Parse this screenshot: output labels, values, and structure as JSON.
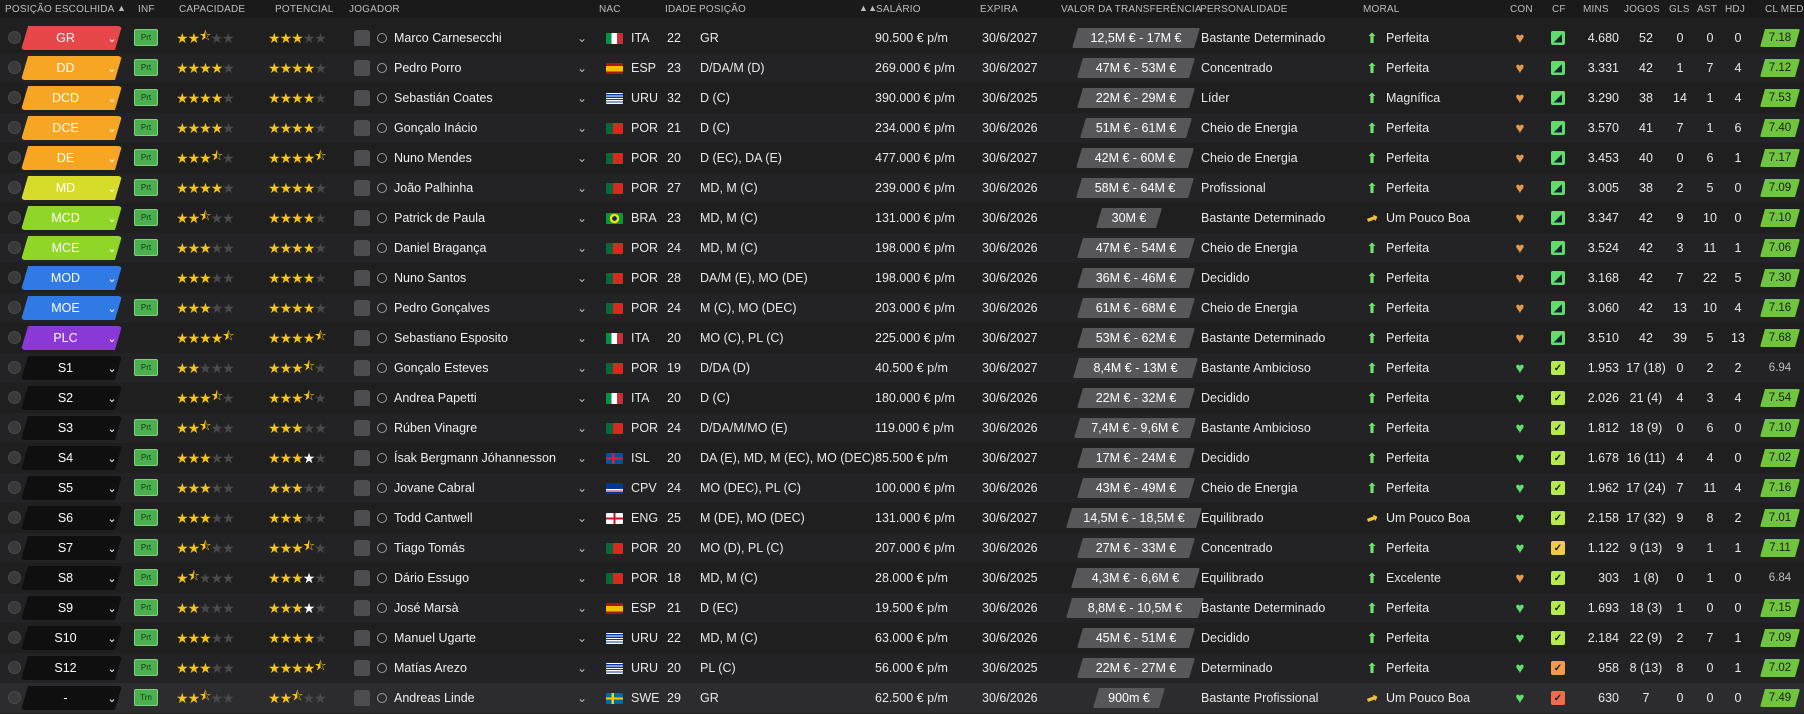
{
  "headers": {
    "posicao": "POSIÇÃO ESCOLHIDA",
    "inf": "INF",
    "capacidade": "CAPACIDADE",
    "potencial": "POTENCIAL",
    "jogador": "JOGADOR",
    "nac": "NAC",
    "idade": "IDADE",
    "posicao2": "POSIÇÃO",
    "salario": "SALÁRIO",
    "expira": "EXPIRA",
    "valor": "VALOR DA TRANSFERÊNCIA",
    "personalidade": "PERSONALIDADE",
    "moral": "MORAL",
    "con": "CON",
    "cf": "CF",
    "mins": "MINS",
    "jogos": "JOGOS",
    "gls": "GLS",
    "ast": "AST",
    "hdj": "HDJ",
    "cl_med": "CL MED"
  },
  "colors": {
    "gold_star": "#f5c518",
    "green": "#4caf50",
    "orange_heart": "#e7964a",
    "green_heart": "#5fe06f"
  },
  "players": [
    {
      "pos": "GR",
      "pos_color": "#e8474a",
      "inf": "Prt",
      "cap": 2.5,
      "pot": 3,
      "pot_white": 0,
      "name": "Marco Carnesecchi",
      "nac": "ITA",
      "flag": "ita",
      "age": "22",
      "position": "GR",
      "salary": "90.500 € p/m",
      "expires": "30/6/2027",
      "value": "12,5M € - 17M €",
      "personality": "Bastante Determinado",
      "moral": "Perfeita",
      "moral_icon": "up",
      "con": "orange",
      "cf": "green",
      "mins": "4.680",
      "jogos": "52",
      "gls": "0",
      "ast": "0",
      "hdj": "0",
      "cl": "7.18",
      "cl_grey": false
    },
    {
      "pos": "DD",
      "pos_color": "#f6a623",
      "inf": "Prt",
      "cap": 4,
      "pot": 4,
      "pot_white": 0,
      "name": "Pedro Porro",
      "nac": "ESP",
      "flag": "esp",
      "age": "23",
      "position": "D/DA/M (D)",
      "salary": "269.000 € p/m",
      "expires": "30/6/2027",
      "value": "47M € - 53M €",
      "personality": "Concentrado",
      "moral": "Perfeita",
      "moral_icon": "up",
      "con": "orange",
      "cf": "green",
      "mins": "3.331",
      "jogos": "42",
      "gls": "1",
      "ast": "7",
      "hdj": "4",
      "cl": "7.12",
      "cl_grey": false
    },
    {
      "pos": "DCD",
      "pos_color": "#f6a623",
      "inf": "Prt",
      "cap": 4,
      "pot": 4,
      "pot_white": 0,
      "name": "Sebastián Coates",
      "nac": "URU",
      "flag": "uru",
      "age": "32",
      "position": "D (C)",
      "salary": "390.000 € p/m",
      "expires": "30/6/2025",
      "value": "22M € - 29M €",
      "personality": "Líder",
      "moral": "Magnífica",
      "moral_icon": "up",
      "con": "orange",
      "cf": "green",
      "mins": "3.290",
      "jogos": "38",
      "gls": "14",
      "ast": "1",
      "hdj": "4",
      "cl": "7.53",
      "cl_grey": false
    },
    {
      "pos": "DCE",
      "pos_color": "#f6a623",
      "inf": "Prt",
      "cap": 4,
      "pot": 4,
      "pot_white": 0,
      "name": "Gonçalo Inácio",
      "nac": "POR",
      "flag": "por",
      "age": "21",
      "position": "D (C)",
      "salary": "234.000 € p/m",
      "expires": "30/6/2026",
      "value": "51M € - 61M €",
      "personality": "Cheio de Energia",
      "moral": "Perfeita",
      "moral_icon": "up",
      "con": "orange",
      "cf": "green",
      "mins": "3.570",
      "jogos": "41",
      "gls": "7",
      "ast": "1",
      "hdj": "6",
      "cl": "7.40",
      "cl_grey": false
    },
    {
      "pos": "DE",
      "pos_color": "#f6a623",
      "inf": "Prt",
      "cap": 3.5,
      "pot": 4.5,
      "pot_white": 0,
      "name": "Nuno Mendes",
      "nac": "POR",
      "flag": "por",
      "age": "20",
      "position": "D (EC), DA (E)",
      "salary": "477.000 € p/m",
      "expires": "30/6/2027",
      "value": "42M € - 60M €",
      "personality": "Cheio de Energia",
      "moral": "Perfeita",
      "moral_icon": "up",
      "con": "orange",
      "cf": "green",
      "mins": "3.453",
      "jogos": "40",
      "gls": "0",
      "ast": "6",
      "hdj": "1",
      "cl": "7.17",
      "cl_grey": false
    },
    {
      "pos": "MD",
      "pos_color": "#d7dc2a",
      "inf": "Prt",
      "cap": 4,
      "pot": 4,
      "pot_white": 0,
      "name": "João Palhinha",
      "nac": "POR",
      "flag": "por",
      "age": "27",
      "position": "MD, M (C)",
      "salary": "239.000 € p/m",
      "expires": "30/6/2026",
      "value": "58M € - 64M €",
      "personality": "Profissional",
      "moral": "Perfeita",
      "moral_icon": "up",
      "con": "orange",
      "cf": "green",
      "mins": "3.005",
      "jogos": "38",
      "gls": "2",
      "ast": "5",
      "hdj": "0",
      "cl": "7.09",
      "cl_grey": false
    },
    {
      "pos": "MCD",
      "pos_color": "#8fd629",
      "inf": "Prt",
      "cap": 2.5,
      "pot": 4,
      "pot_white": 0,
      "name": "Patrick de Paula",
      "nac": "BRA",
      "flag": "bra",
      "age": "23",
      "position": "MD, M (C)",
      "salary": "131.000 € p/m",
      "expires": "30/6/2026",
      "value": "30M €",
      "personality": "Bastante Determinado",
      "moral": "Um Pouco Boa",
      "moral_icon": "side",
      "con": "orange",
      "cf": "green",
      "mins": "3.347",
      "jogos": "42",
      "gls": "9",
      "ast": "10",
      "hdj": "0",
      "cl": "7.10",
      "cl_grey": false
    },
    {
      "pos": "MCE",
      "pos_color": "#8fd629",
      "inf": "Prt",
      "cap": 3,
      "pot": 4,
      "pot_white": 0,
      "name": "Daniel Bragança",
      "nac": "POR",
      "flag": "por",
      "age": "24",
      "position": "MD, M (C)",
      "salary": "198.000 € p/m",
      "expires": "30/6/2026",
      "value": "47M € - 54M €",
      "personality": "Cheio de Energia",
      "moral": "Perfeita",
      "moral_icon": "up",
      "con": "orange",
      "cf": "green",
      "mins": "3.524",
      "jogos": "42",
      "gls": "3",
      "ast": "11",
      "hdj": "1",
      "cl": "7.06",
      "cl_grey": false
    },
    {
      "pos": "MOD",
      "pos_color": "#2f7ae5",
      "inf": "",
      "cap": 3,
      "pot": 4,
      "pot_white": 0,
      "name": "Nuno Santos",
      "nac": "POR",
      "flag": "por",
      "age": "28",
      "position": "DA/M (E), MO (DE)",
      "salary": "198.000 € p/m",
      "expires": "30/6/2026",
      "value": "36M € - 46M €",
      "personality": "Decidido",
      "moral": "Perfeita",
      "moral_icon": "up",
      "con": "orange",
      "cf": "green",
      "mins": "3.168",
      "jogos": "42",
      "gls": "7",
      "ast": "22",
      "hdj": "5",
      "cl": "7.30",
      "cl_grey": false
    },
    {
      "pos": "MOE",
      "pos_color": "#2f7ae5",
      "inf": "Prt",
      "cap": 3,
      "pot": 4,
      "pot_white": 0,
      "name": "Pedro Gonçalves",
      "nac": "POR",
      "flag": "por",
      "age": "24",
      "position": "M (C), MO (DEC)",
      "salary": "203.000 € p/m",
      "expires": "30/6/2026",
      "value": "61M € - 68M €",
      "personality": "Cheio de Energia",
      "moral": "Perfeita",
      "moral_icon": "up",
      "con": "orange",
      "cf": "green",
      "mins": "3.060",
      "jogos": "42",
      "gls": "13",
      "ast": "10",
      "hdj": "4",
      "cl": "7.16",
      "cl_grey": false
    },
    {
      "pos": "PLC",
      "pos_color": "#8a38d6",
      "inf": "",
      "cap": 4.5,
      "pot": 4.5,
      "pot_white": 0,
      "name": "Sebastiano Esposito",
      "nac": "ITA",
      "flag": "ita",
      "age": "20",
      "position": "MO (C), PL (C)",
      "salary": "225.000 € p/m",
      "expires": "30/6/2027",
      "value": "53M € - 62M €",
      "personality": "Bastante Determinado",
      "moral": "Perfeita",
      "moral_icon": "up",
      "con": "orange",
      "cf": "green",
      "mins": "3.510",
      "jogos": "42",
      "gls": "39",
      "ast": "5",
      "hdj": "13",
      "cl": "7.68",
      "cl_grey": false
    },
    {
      "pos": "S1",
      "pos_color": "#0f0f10",
      "inf": "Prt",
      "cap": 2,
      "pot": 3.5,
      "pot_white": 0,
      "name": "Gonçalo Esteves",
      "nac": "POR",
      "flag": "por",
      "age": "19",
      "position": "D/DA (D)",
      "salary": "40.500 € p/m",
      "expires": "30/6/2027",
      "value": "8,4M € - 13M €",
      "personality": "Bastante Ambicioso",
      "moral": "Perfeita",
      "moral_icon": "up",
      "con": "green",
      "cf": "lime",
      "mins": "1.953",
      "jogos": "17 (18)",
      "gls": "0",
      "ast": "2",
      "hdj": "2",
      "cl": "6.94",
      "cl_grey": true
    },
    {
      "pos": "S2",
      "pos_color": "#0f0f10",
      "inf": "",
      "cap": 3.5,
      "pot": 3.5,
      "pot_white": 0,
      "name": "Andrea Papetti",
      "nac": "ITA",
      "flag": "ita",
      "age": "20",
      "position": "D (C)",
      "salary": "180.000 € p/m",
      "expires": "30/6/2026",
      "value": "22M € - 32M €",
      "personality": "Decidido",
      "moral": "Perfeita",
      "moral_icon": "up",
      "con": "green",
      "cf": "lime",
      "mins": "2.026",
      "jogos": "21 (4)",
      "gls": "4",
      "ast": "3",
      "hdj": "4",
      "cl": "7.54",
      "cl_grey": false
    },
    {
      "pos": "S3",
      "pos_color": "#0f0f10",
      "inf": "Prt",
      "cap": 2.5,
      "pot": 3,
      "pot_white": 0,
      "name": "Rúben Vinagre",
      "nac": "POR",
      "flag": "por",
      "age": "24",
      "position": "D/DA/M/MO (E)",
      "salary": "119.000 € p/m",
      "expires": "30/6/2026",
      "value": "7,4M € - 9,6M €",
      "personality": "Bastante Ambicioso",
      "moral": "Perfeita",
      "moral_icon": "up",
      "con": "green",
      "cf": "lime",
      "mins": "1.812",
      "jogos": "18 (9)",
      "gls": "0",
      "ast": "6",
      "hdj": "0",
      "cl": "7.10",
      "cl_grey": false
    },
    {
      "pos": "S4",
      "pos_color": "#0f0f10",
      "inf": "Prt",
      "cap": 3,
      "pot": 3,
      "pot_white": 1,
      "name": "Ísak Bergmann Jóhannesson",
      "nac": "ISL",
      "flag": "isl",
      "age": "20",
      "position": "DA (E), MD, M (EC), MO (DEC)",
      "salary": "85.500 € p/m",
      "expires": "30/6/2027",
      "value": "17M € - 24M €",
      "personality": "Decidido",
      "moral": "Perfeita",
      "moral_icon": "up",
      "con": "green",
      "cf": "lime",
      "mins": "1.678",
      "jogos": "16 (11)",
      "gls": "4",
      "ast": "4",
      "hdj": "0",
      "cl": "7.02",
      "cl_grey": false
    },
    {
      "pos": "S5",
      "pos_color": "#0f0f10",
      "inf": "Prt",
      "cap": 3,
      "pot": 3,
      "pot_white": 0,
      "name": "Jovane Cabral",
      "nac": "CPV",
      "flag": "cpv",
      "age": "24",
      "position": "MO (DEC), PL (C)",
      "salary": "100.000 € p/m",
      "expires": "30/6/2026",
      "value": "43M € - 49M €",
      "personality": "Cheio de Energia",
      "moral": "Perfeita",
      "moral_icon": "up",
      "con": "green",
      "cf": "lime",
      "mins": "1.962",
      "jogos": "17 (24)",
      "gls": "7",
      "ast": "11",
      "hdj": "4",
      "cl": "7.16",
      "cl_grey": false
    },
    {
      "pos": "S6",
      "pos_color": "#0f0f10",
      "inf": "Prt",
      "cap": 3,
      "pot": 3,
      "pot_white": 0,
      "name": "Todd Cantwell",
      "nac": "ENG",
      "flag": "eng",
      "age": "25",
      "position": "M (DE), MO (DEC)",
      "salary": "131.000 € p/m",
      "expires": "30/6/2027",
      "value": "14,5M € - 18,5M €",
      "personality": "Equilibrado",
      "moral": "Um Pouco Boa",
      "moral_icon": "side",
      "con": "green",
      "cf": "lime",
      "mins": "2.158",
      "jogos": "17 (32)",
      "gls": "9",
      "ast": "8",
      "hdj": "2",
      "cl": "7.01",
      "cl_grey": false
    },
    {
      "pos": "S7",
      "pos_color": "#0f0f10",
      "inf": "Prt",
      "cap": 2.5,
      "pot": 3.5,
      "pot_white": 0,
      "name": "Tiago Tomás",
      "nac": "POR",
      "flag": "por",
      "age": "20",
      "position": "MO (D), PL (C)",
      "salary": "207.000 € p/m",
      "expires": "30/6/2026",
      "value": "27M € - 33M €",
      "personality": "Concentrado",
      "moral": "Perfeita",
      "moral_icon": "up",
      "con": "green",
      "cf": "amber",
      "mins": "1.122",
      "jogos": "9 (13)",
      "gls": "9",
      "ast": "1",
      "hdj": "1",
      "cl": "7.11",
      "cl_grey": false
    },
    {
      "pos": "S8",
      "pos_color": "#0f0f10",
      "inf": "Prt",
      "cap": 1.5,
      "pot": 3,
      "pot_white": 1,
      "name": "Dário Essugo",
      "nac": "POR",
      "flag": "por",
      "age": "18",
      "position": "MD, M (C)",
      "salary": "28.000 € p/m",
      "expires": "30/6/2025",
      "value": "4,3M € - 6,6M €",
      "personality": "Equilibrado",
      "moral": "Excelente",
      "moral_icon": "up",
      "con": "orange",
      "cf": "lime",
      "mins": "303",
      "jogos": "1 (8)",
      "gls": "0",
      "ast": "1",
      "hdj": "0",
      "cl": "6.84",
      "cl_grey": true
    },
    {
      "pos": "S9",
      "pos_color": "#0f0f10",
      "inf": "Prt",
      "cap": 2,
      "pot": 3,
      "pot_white": 1,
      "name": "José Marsà",
      "nac": "ESP",
      "flag": "esp",
      "age": "21",
      "position": "D (EC)",
      "salary": "19.500 € p/m",
      "expires": "30/6/2026",
      "value": "8,8M € - 10,5M €",
      "personality": "Bastante Determinado",
      "moral": "Perfeita",
      "moral_icon": "up",
      "con": "green",
      "cf": "lime",
      "mins": "1.693",
      "jogos": "18 (3)",
      "gls": "1",
      "ast": "0",
      "hdj": "0",
      "cl": "7.15",
      "cl_grey": false
    },
    {
      "pos": "S10",
      "pos_color": "#0f0f10",
      "inf": "Prt",
      "cap": 3,
      "pot": 4,
      "pot_white": 0,
      "name": "Manuel Ugarte",
      "nac": "URU",
      "flag": "uru",
      "age": "22",
      "position": "MD, M (C)",
      "salary": "63.000 € p/m",
      "expires": "30/6/2026",
      "value": "45M € - 51M €",
      "personality": "Decidido",
      "moral": "Perfeita",
      "moral_icon": "up",
      "con": "green",
      "cf": "lime",
      "mins": "2.184",
      "jogos": "22 (9)",
      "gls": "2",
      "ast": "7",
      "hdj": "1",
      "cl": "7.09",
      "cl_grey": false
    },
    {
      "pos": "S12",
      "pos_color": "#0f0f10",
      "inf": "Prt",
      "cap": 3,
      "pot": 4.5,
      "pot_white": 0,
      "name": "Matías Arezo",
      "nac": "URU",
      "flag": "uru",
      "age": "20",
      "position": "PL (C)",
      "salary": "56.000 € p/m",
      "expires": "30/6/2025",
      "value": "22M € - 27M €",
      "personality": "Determinado",
      "moral": "Perfeita",
      "moral_icon": "up",
      "con": "green",
      "cf": "orange",
      "mins": "958",
      "jogos": "8 (13)",
      "gls": "8",
      "ast": "0",
      "hdj": "1",
      "cl": "7.02",
      "cl_grey": false
    },
    {
      "pos": "-",
      "pos_color": "#0f0f10",
      "inf": "Trn",
      "cap": 2.5,
      "pot": 2.5,
      "pot_white": 0,
      "name": "Andreas Linde",
      "nac": "SWE",
      "flag": "swe",
      "age": "29",
      "position": "GR",
      "salary": "62.500 € p/m",
      "expires": "30/6/2026",
      "value": "900m €",
      "personality": "Bastante Profissional",
      "moral": "Um Pouco Boa",
      "moral_icon": "side",
      "con": "green",
      "cf": "red",
      "mins": "630",
      "jogos": "7",
      "gls": "0",
      "ast": "0",
      "hdj": "0",
      "cl": "7.49",
      "cl_grey": false
    }
  ]
}
